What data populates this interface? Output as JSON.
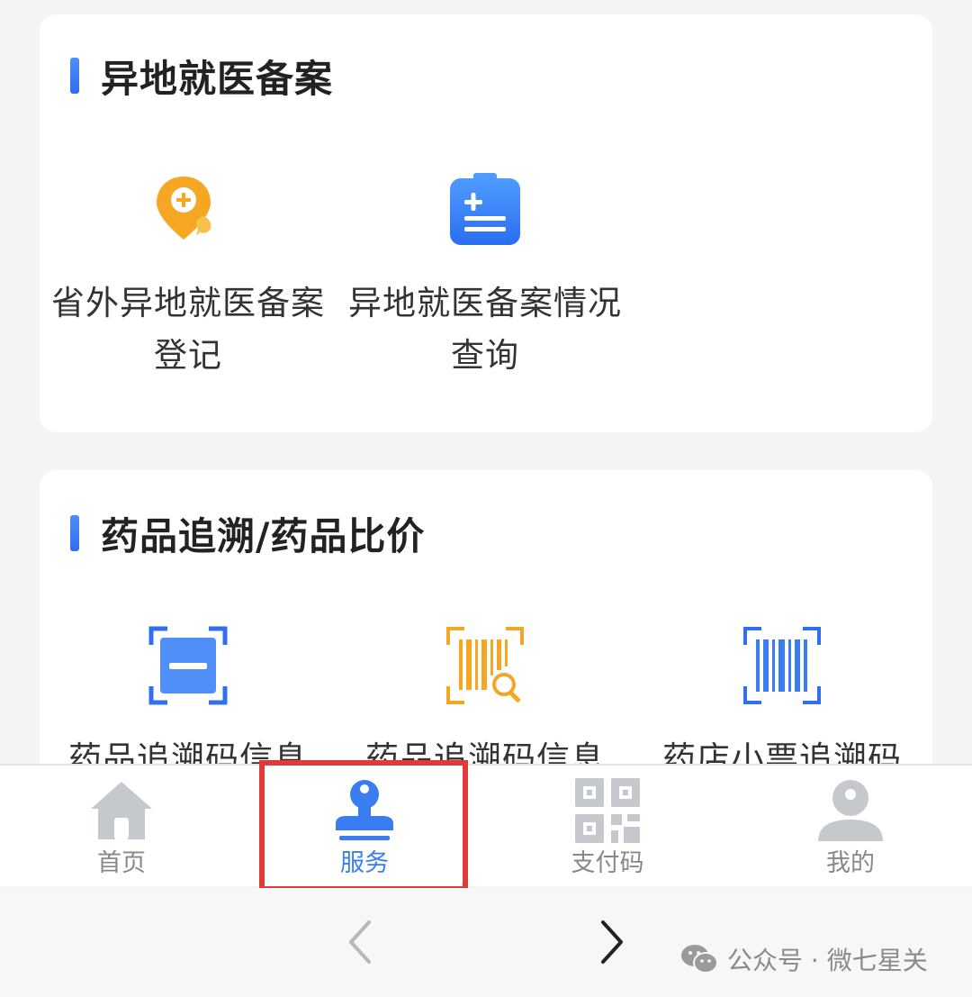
{
  "sections": {
    "remote_filing": {
      "title": "异地就医备案",
      "items": [
        {
          "label": "省外异地就医备案登记",
          "icon": "location-plus-icon"
        },
        {
          "label": "异地就医备案情况查询",
          "icon": "clipboard-plus-icon"
        }
      ]
    },
    "drug_trace": {
      "title": "药品追溯/药品比价",
      "items": [
        {
          "label": "药品追溯码信息",
          "icon": "scan-frame-icon"
        },
        {
          "label": "药品追溯码信息",
          "icon": "barcode-search-icon"
        },
        {
          "label": "药店小票追溯码",
          "icon": "barcode-scan-icon"
        }
      ]
    }
  },
  "tabbar": {
    "tabs": [
      {
        "label": "首页",
        "icon": "home-icon"
      },
      {
        "label": "服务",
        "icon": "stamp-icon",
        "active": true
      },
      {
        "label": "支付码",
        "icon": "qr-code-icon"
      },
      {
        "label": "我的",
        "icon": "user-icon"
      }
    ]
  },
  "navbar": {
    "watermark": "公众号 · 微七星关"
  },
  "colors": {
    "accent": "#3a7df1",
    "highlight": "#e03a3a",
    "orange": "#f5a623",
    "inactive": "#c5c8cc"
  }
}
